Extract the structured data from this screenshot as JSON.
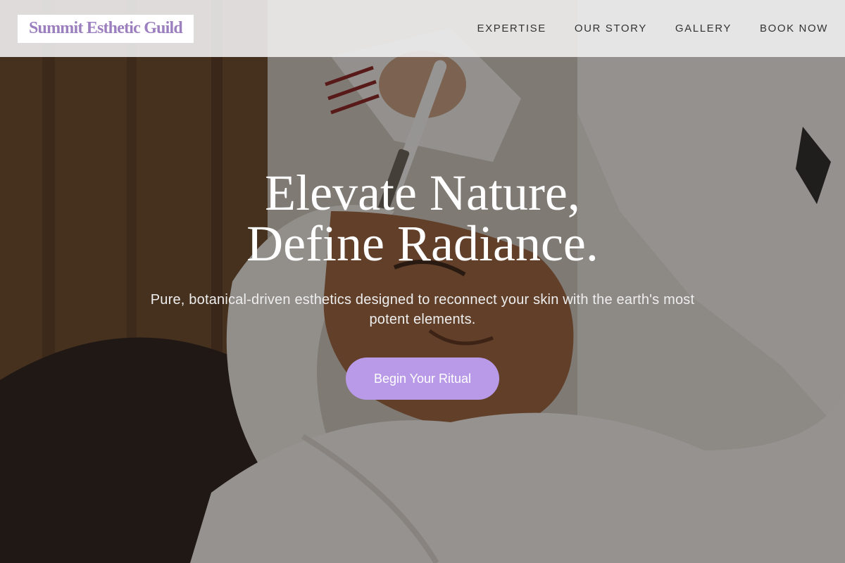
{
  "brand": {
    "name": "Summit Esthetic Guild",
    "logo_color": "#9b7fbe"
  },
  "nav": {
    "items": [
      {
        "label": "EXPERTISE"
      },
      {
        "label": "OUR STORY"
      },
      {
        "label": "GALLERY"
      },
      {
        "label": "BOOK NOW"
      }
    ]
  },
  "hero": {
    "title_line1": "Elevate Nature,",
    "title_line2": "Define Radiance.",
    "subtitle": "Pure, botanical-driven esthetics designed to reconnect your skin with the earth's most potent elements.",
    "cta_label": "Begin Your Ritual",
    "cta_color": "#b99ae8",
    "background_image": "spa-facial-photo"
  }
}
